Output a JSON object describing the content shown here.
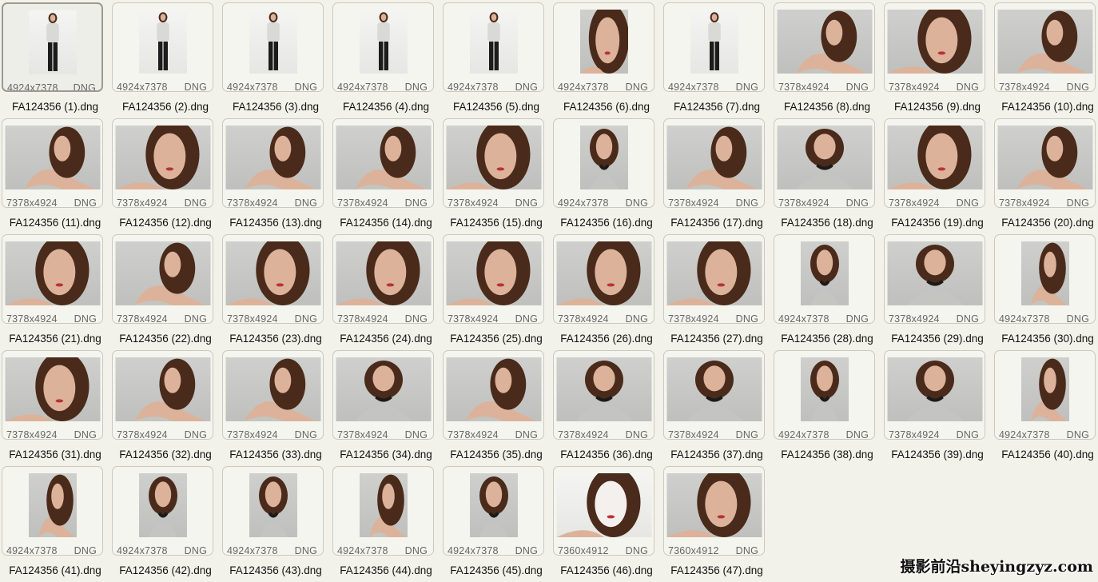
{
  "items": [
    {
      "name": "FA124356 (1).dng",
      "dims": "4924x7378",
      "ext": "DNG",
      "orientation": "portrait",
      "bg": "light",
      "pose": "fullbody",
      "selected": true
    },
    {
      "name": "FA124356 (2).dng",
      "dims": "4924x7378",
      "ext": "DNG",
      "orientation": "portrait",
      "bg": "light",
      "pose": "fullbody"
    },
    {
      "name": "FA124356 (3).dng",
      "dims": "4924x7378",
      "ext": "DNG",
      "orientation": "portrait",
      "bg": "light",
      "pose": "fullbody"
    },
    {
      "name": "FA124356 (4).dng",
      "dims": "4924x7378",
      "ext": "DNG",
      "orientation": "portrait",
      "bg": "light",
      "pose": "fullbody"
    },
    {
      "name": "FA124356 (5).dng",
      "dims": "4924x7378",
      "ext": "DNG",
      "orientation": "portrait",
      "bg": "light",
      "pose": "fullbody"
    },
    {
      "name": "FA124356 (6).dng",
      "dims": "4924x7378",
      "ext": "DNG",
      "orientation": "portrait",
      "bg": "grey",
      "pose": "face"
    },
    {
      "name": "FA124356 (7).dng",
      "dims": "4924x7378",
      "ext": "DNG",
      "orientation": "portrait",
      "bg": "light",
      "pose": "fullbody"
    },
    {
      "name": "FA124356 (8).dng",
      "dims": "7378x4924",
      "ext": "DNG",
      "orientation": "landscape",
      "bg": "grey",
      "pose": "shoulder"
    },
    {
      "name": "FA124356 (9).dng",
      "dims": "7378x4924",
      "ext": "DNG",
      "orientation": "landscape",
      "bg": "grey",
      "pose": "face"
    },
    {
      "name": "FA124356 (10).dng",
      "dims": "7378x4924",
      "ext": "DNG",
      "orientation": "landscape",
      "bg": "grey",
      "pose": "shoulder"
    },
    {
      "name": "FA124356 (11).dng",
      "dims": "7378x4924",
      "ext": "DNG",
      "orientation": "landscape",
      "bg": "grey",
      "pose": "shoulder"
    },
    {
      "name": "FA124356 (12).dng",
      "dims": "7378x4924",
      "ext": "DNG",
      "orientation": "landscape",
      "bg": "grey",
      "pose": "face"
    },
    {
      "name": "FA124356 (13).dng",
      "dims": "7378x4924",
      "ext": "DNG",
      "orientation": "landscape",
      "bg": "grey",
      "pose": "shoulder"
    },
    {
      "name": "FA124356 (14).dng",
      "dims": "7378x4924",
      "ext": "DNG",
      "orientation": "landscape",
      "bg": "grey",
      "pose": "shoulder"
    },
    {
      "name": "FA124356 (15).dng",
      "dims": "7378x4924",
      "ext": "DNG",
      "orientation": "landscape",
      "bg": "grey",
      "pose": "face"
    },
    {
      "name": "FA124356 (16).dng",
      "dims": "4924x7378",
      "ext": "DNG",
      "orientation": "portrait",
      "bg": "grey",
      "pose": "bust"
    },
    {
      "name": "FA124356 (17).dng",
      "dims": "7378x4924",
      "ext": "DNG",
      "orientation": "landscape",
      "bg": "grey",
      "pose": "shoulder"
    },
    {
      "name": "FA124356 (18).dng",
      "dims": "7378x4924",
      "ext": "DNG",
      "orientation": "landscape",
      "bg": "grey",
      "pose": "bust"
    },
    {
      "name": "FA124356 (19).dng",
      "dims": "7378x4924",
      "ext": "DNG",
      "orientation": "landscape",
      "bg": "grey",
      "pose": "face"
    },
    {
      "name": "FA124356 (20).dng",
      "dims": "7378x4924",
      "ext": "DNG",
      "orientation": "landscape",
      "bg": "grey",
      "pose": "shoulder"
    },
    {
      "name": "FA124356 (21).dng",
      "dims": "7378x4924",
      "ext": "DNG",
      "orientation": "landscape",
      "bg": "grey",
      "pose": "face"
    },
    {
      "name": "FA124356 (22).dng",
      "dims": "7378x4924",
      "ext": "DNG",
      "orientation": "landscape",
      "bg": "grey",
      "pose": "shoulder"
    },
    {
      "name": "FA124356 (23).dng",
      "dims": "7378x4924",
      "ext": "DNG",
      "orientation": "landscape",
      "bg": "grey",
      "pose": "face"
    },
    {
      "name": "FA124356 (24).dng",
      "dims": "7378x4924",
      "ext": "DNG",
      "orientation": "landscape",
      "bg": "grey",
      "pose": "face"
    },
    {
      "name": "FA124356 (25).dng",
      "dims": "7378x4924",
      "ext": "DNG",
      "orientation": "landscape",
      "bg": "grey",
      "pose": "face"
    },
    {
      "name": "FA124356 (26).dng",
      "dims": "7378x4924",
      "ext": "DNG",
      "orientation": "landscape",
      "bg": "grey",
      "pose": "face"
    },
    {
      "name": "FA124356 (27).dng",
      "dims": "7378x4924",
      "ext": "DNG",
      "orientation": "landscape",
      "bg": "grey",
      "pose": "face"
    },
    {
      "name": "FA124356 (28).dng",
      "dims": "4924x7378",
      "ext": "DNG",
      "orientation": "portrait",
      "bg": "grey",
      "pose": "bust"
    },
    {
      "name": "FA124356 (29).dng",
      "dims": "7378x4924",
      "ext": "DNG",
      "orientation": "landscape",
      "bg": "grey",
      "pose": "bust"
    },
    {
      "name": "FA124356 (30).dng",
      "dims": "4924x7378",
      "ext": "DNG",
      "orientation": "portrait",
      "bg": "grey",
      "pose": "shoulder"
    },
    {
      "name": "FA124356 (31).dng",
      "dims": "7378x4924",
      "ext": "DNG",
      "orientation": "landscape",
      "bg": "grey",
      "pose": "face"
    },
    {
      "name": "FA124356 (32).dng",
      "dims": "7378x4924",
      "ext": "DNG",
      "orientation": "landscape",
      "bg": "grey",
      "pose": "shoulder"
    },
    {
      "name": "FA124356 (33).dng",
      "dims": "7378x4924",
      "ext": "DNG",
      "orientation": "landscape",
      "bg": "grey",
      "pose": "shoulder"
    },
    {
      "name": "FA124356 (34).dng",
      "dims": "7378x4924",
      "ext": "DNG",
      "orientation": "landscape",
      "bg": "grey",
      "pose": "bust"
    },
    {
      "name": "FA124356 (35).dng",
      "dims": "7378x4924",
      "ext": "DNG",
      "orientation": "landscape",
      "bg": "grey",
      "pose": "shoulder"
    },
    {
      "name": "FA124356 (36).dng",
      "dims": "7378x4924",
      "ext": "DNG",
      "orientation": "landscape",
      "bg": "grey",
      "pose": "bust"
    },
    {
      "name": "FA124356 (37).dng",
      "dims": "7378x4924",
      "ext": "DNG",
      "orientation": "landscape",
      "bg": "grey",
      "pose": "bust"
    },
    {
      "name": "FA124356 (38).dng",
      "dims": "4924x7378",
      "ext": "DNG",
      "orientation": "portrait",
      "bg": "grey",
      "pose": "bust"
    },
    {
      "name": "FA124356 (39).dng",
      "dims": "7378x4924",
      "ext": "DNG",
      "orientation": "landscape",
      "bg": "grey",
      "pose": "bust"
    },
    {
      "name": "FA124356 (40).dng",
      "dims": "4924x7378",
      "ext": "DNG",
      "orientation": "portrait",
      "bg": "grey",
      "pose": "shoulder"
    },
    {
      "name": "FA124356 (41).dng",
      "dims": "4924x7378",
      "ext": "DNG",
      "orientation": "portrait",
      "bg": "grey",
      "pose": "shoulder"
    },
    {
      "name": "FA124356 (42).dng",
      "dims": "4924x7378",
      "ext": "DNG",
      "orientation": "portrait",
      "bg": "grey",
      "pose": "bust"
    },
    {
      "name": "FA124356 (43).dng",
      "dims": "4924x7378",
      "ext": "DNG",
      "orientation": "portrait",
      "bg": "grey",
      "pose": "bust"
    },
    {
      "name": "FA124356 (44).dng",
      "dims": "4924x7378",
      "ext": "DNG",
      "orientation": "portrait",
      "bg": "grey",
      "pose": "shoulder"
    },
    {
      "name": "FA124356 (45).dng",
      "dims": "4924x7378",
      "ext": "DNG",
      "orientation": "portrait",
      "bg": "grey",
      "pose": "bust"
    },
    {
      "name": "FA124356 (46).dng",
      "dims": "7360x4912",
      "ext": "DNG",
      "orientation": "landscape",
      "bg": "light",
      "pose": "closeup-pale"
    },
    {
      "name": "FA124356 (47).dng",
      "dims": "7360x4912",
      "ext": "DNG",
      "orientation": "landscape",
      "bg": "grey",
      "pose": "closeup"
    }
  ],
  "watermark": "摄影前沿sheyingzyz.com",
  "colors": {
    "background": "#f3f2ea",
    "hair": "#4a2a1a",
    "skin": "#dcb29a",
    "sweater": "#c4c4c0",
    "necklace": "#1a1a1a",
    "lips": "#b8323a"
  }
}
